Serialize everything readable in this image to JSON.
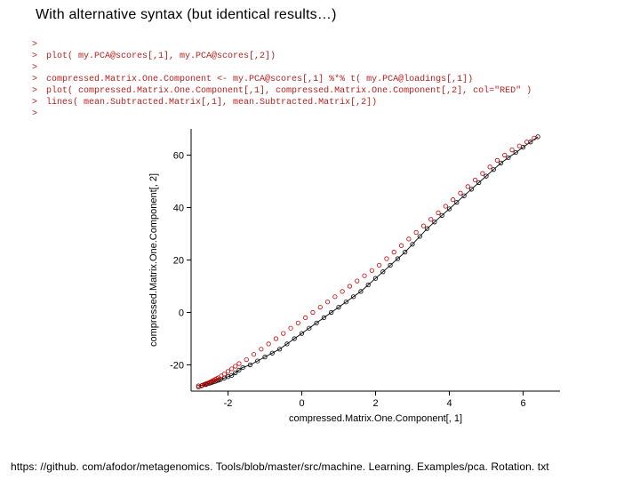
{
  "title": "With alternative syntax (but identical results…)",
  "code_lines": [
    "",
    "plot( my.PCA@scores[,1], my.PCA@scores[,2])",
    "",
    "compressed.Matrix.One.Component <- my.PCA@scores[,1] %*% t( my.PCA@loadings[,1])",
    "plot( compressed.Matrix.One.Component[,1], compressed.Matrix.One.Component[,2], col=\"RED\" )",
    "lines( mean.Subtracted.Matrix[,1], mean.Subtracted.Matrix[,2])",
    ""
  ],
  "footer_url": "https: //github. com/afodor/metagenomics. Tools/blob/master/src/machine. Learning. Examples/pca. Rotation. txt",
  "chart_data": {
    "type": "scatter",
    "xlabel": "compressed.Matrix.One.Component[, 1]",
    "ylabel": "compressed.Matrix.One.Component[, 2]",
    "xlim": [
      -3,
      7
    ],
    "ylim": [
      -30,
      70
    ],
    "xticks": [
      -2,
      0,
      2,
      4,
      6
    ],
    "yticks": [
      -20,
      0,
      20,
      40,
      60
    ],
    "series": [
      {
        "name": "mean.Subtracted.Matrix (black line/points)",
        "color": "#000000",
        "x": [
          -2.8,
          -2.7,
          -2.6,
          -2.58,
          -2.55,
          -2.5,
          -2.45,
          -2.4,
          -2.35,
          -2.3,
          -2.25,
          -2.2,
          -2.1,
          -2.0,
          -1.9,
          -1.8,
          -1.7,
          -1.6,
          -1.4,
          -1.2,
          -1.0,
          -0.8,
          -0.6,
          -0.4,
          -0.2,
          0.0,
          0.2,
          0.4,
          0.6,
          0.8,
          1.0,
          1.2,
          1.4,
          1.6,
          1.8,
          2.0,
          2.2,
          2.4,
          2.6,
          2.8,
          3.0,
          3.2,
          3.4,
          3.6,
          3.8,
          4.0,
          4.2,
          4.4,
          4.6,
          4.8,
          5.0,
          5.2,
          5.4,
          5.6,
          5.8,
          6.0,
          6.2,
          6.4
        ],
        "y": [
          -28,
          -27.8,
          -27.5,
          -27.3,
          -27.1,
          -27,
          -26.8,
          -26.5,
          -26.3,
          -26,
          -25.8,
          -25.5,
          -25,
          -24.5,
          -24,
          -23,
          -22,
          -21,
          -20,
          -18.5,
          -17,
          -15.5,
          -14,
          -12,
          -10,
          -8,
          -6,
          -4,
          -2,
          0,
          2,
          4,
          6,
          8,
          10.5,
          13,
          15.5,
          18,
          20.5,
          23,
          26,
          29,
          32,
          34.5,
          37,
          39.5,
          42,
          44.5,
          47,
          49.5,
          52,
          54.5,
          57,
          59,
          61,
          63,
          65,
          67
        ]
      },
      {
        "name": "compressed.Matrix.One.Component (red points)",
        "color": "#cc0000",
        "x": [
          -2.8,
          -2.72,
          -2.65,
          -2.6,
          -2.55,
          -2.5,
          -2.46,
          -2.42,
          -2.38,
          -2.34,
          -2.3,
          -2.26,
          -2.18,
          -2.1,
          -2.0,
          -1.9,
          -1.8,
          -1.7,
          -1.5,
          -1.3,
          -1.1,
          -0.9,
          -0.7,
          -0.5,
          -0.3,
          -0.1,
          0.1,
          0.3,
          0.5,
          0.7,
          0.9,
          1.1,
          1.3,
          1.5,
          1.7,
          1.9,
          2.1,
          2.3,
          2.5,
          2.7,
          2.9,
          3.1,
          3.3,
          3.5,
          3.7,
          3.9,
          4.1,
          4.3,
          4.5,
          4.7,
          4.9,
          5.1,
          5.3,
          5.5,
          5.7,
          5.9,
          6.1,
          6.3
        ],
        "y": [
          -28.5,
          -28,
          -27.5,
          -27.2,
          -27,
          -26.7,
          -26.4,
          -26.1,
          -25.8,
          -25.5,
          -25.2,
          -24.9,
          -24.2,
          -23.5,
          -22.5,
          -21.5,
          -20.5,
          -19.5,
          -18,
          -16,
          -14,
          -12,
          -10,
          -8,
          -6,
          -4,
          -2,
          0,
          2,
          4,
          6,
          8,
          10,
          12,
          14,
          16,
          18,
          20.5,
          23,
          25.5,
          28,
          30.5,
          33,
          35.5,
          38,
          40.5,
          43,
          45.5,
          48,
          50.5,
          53,
          55.5,
          58,
          60,
          62,
          63.5,
          65,
          66.5
        ]
      }
    ]
  }
}
